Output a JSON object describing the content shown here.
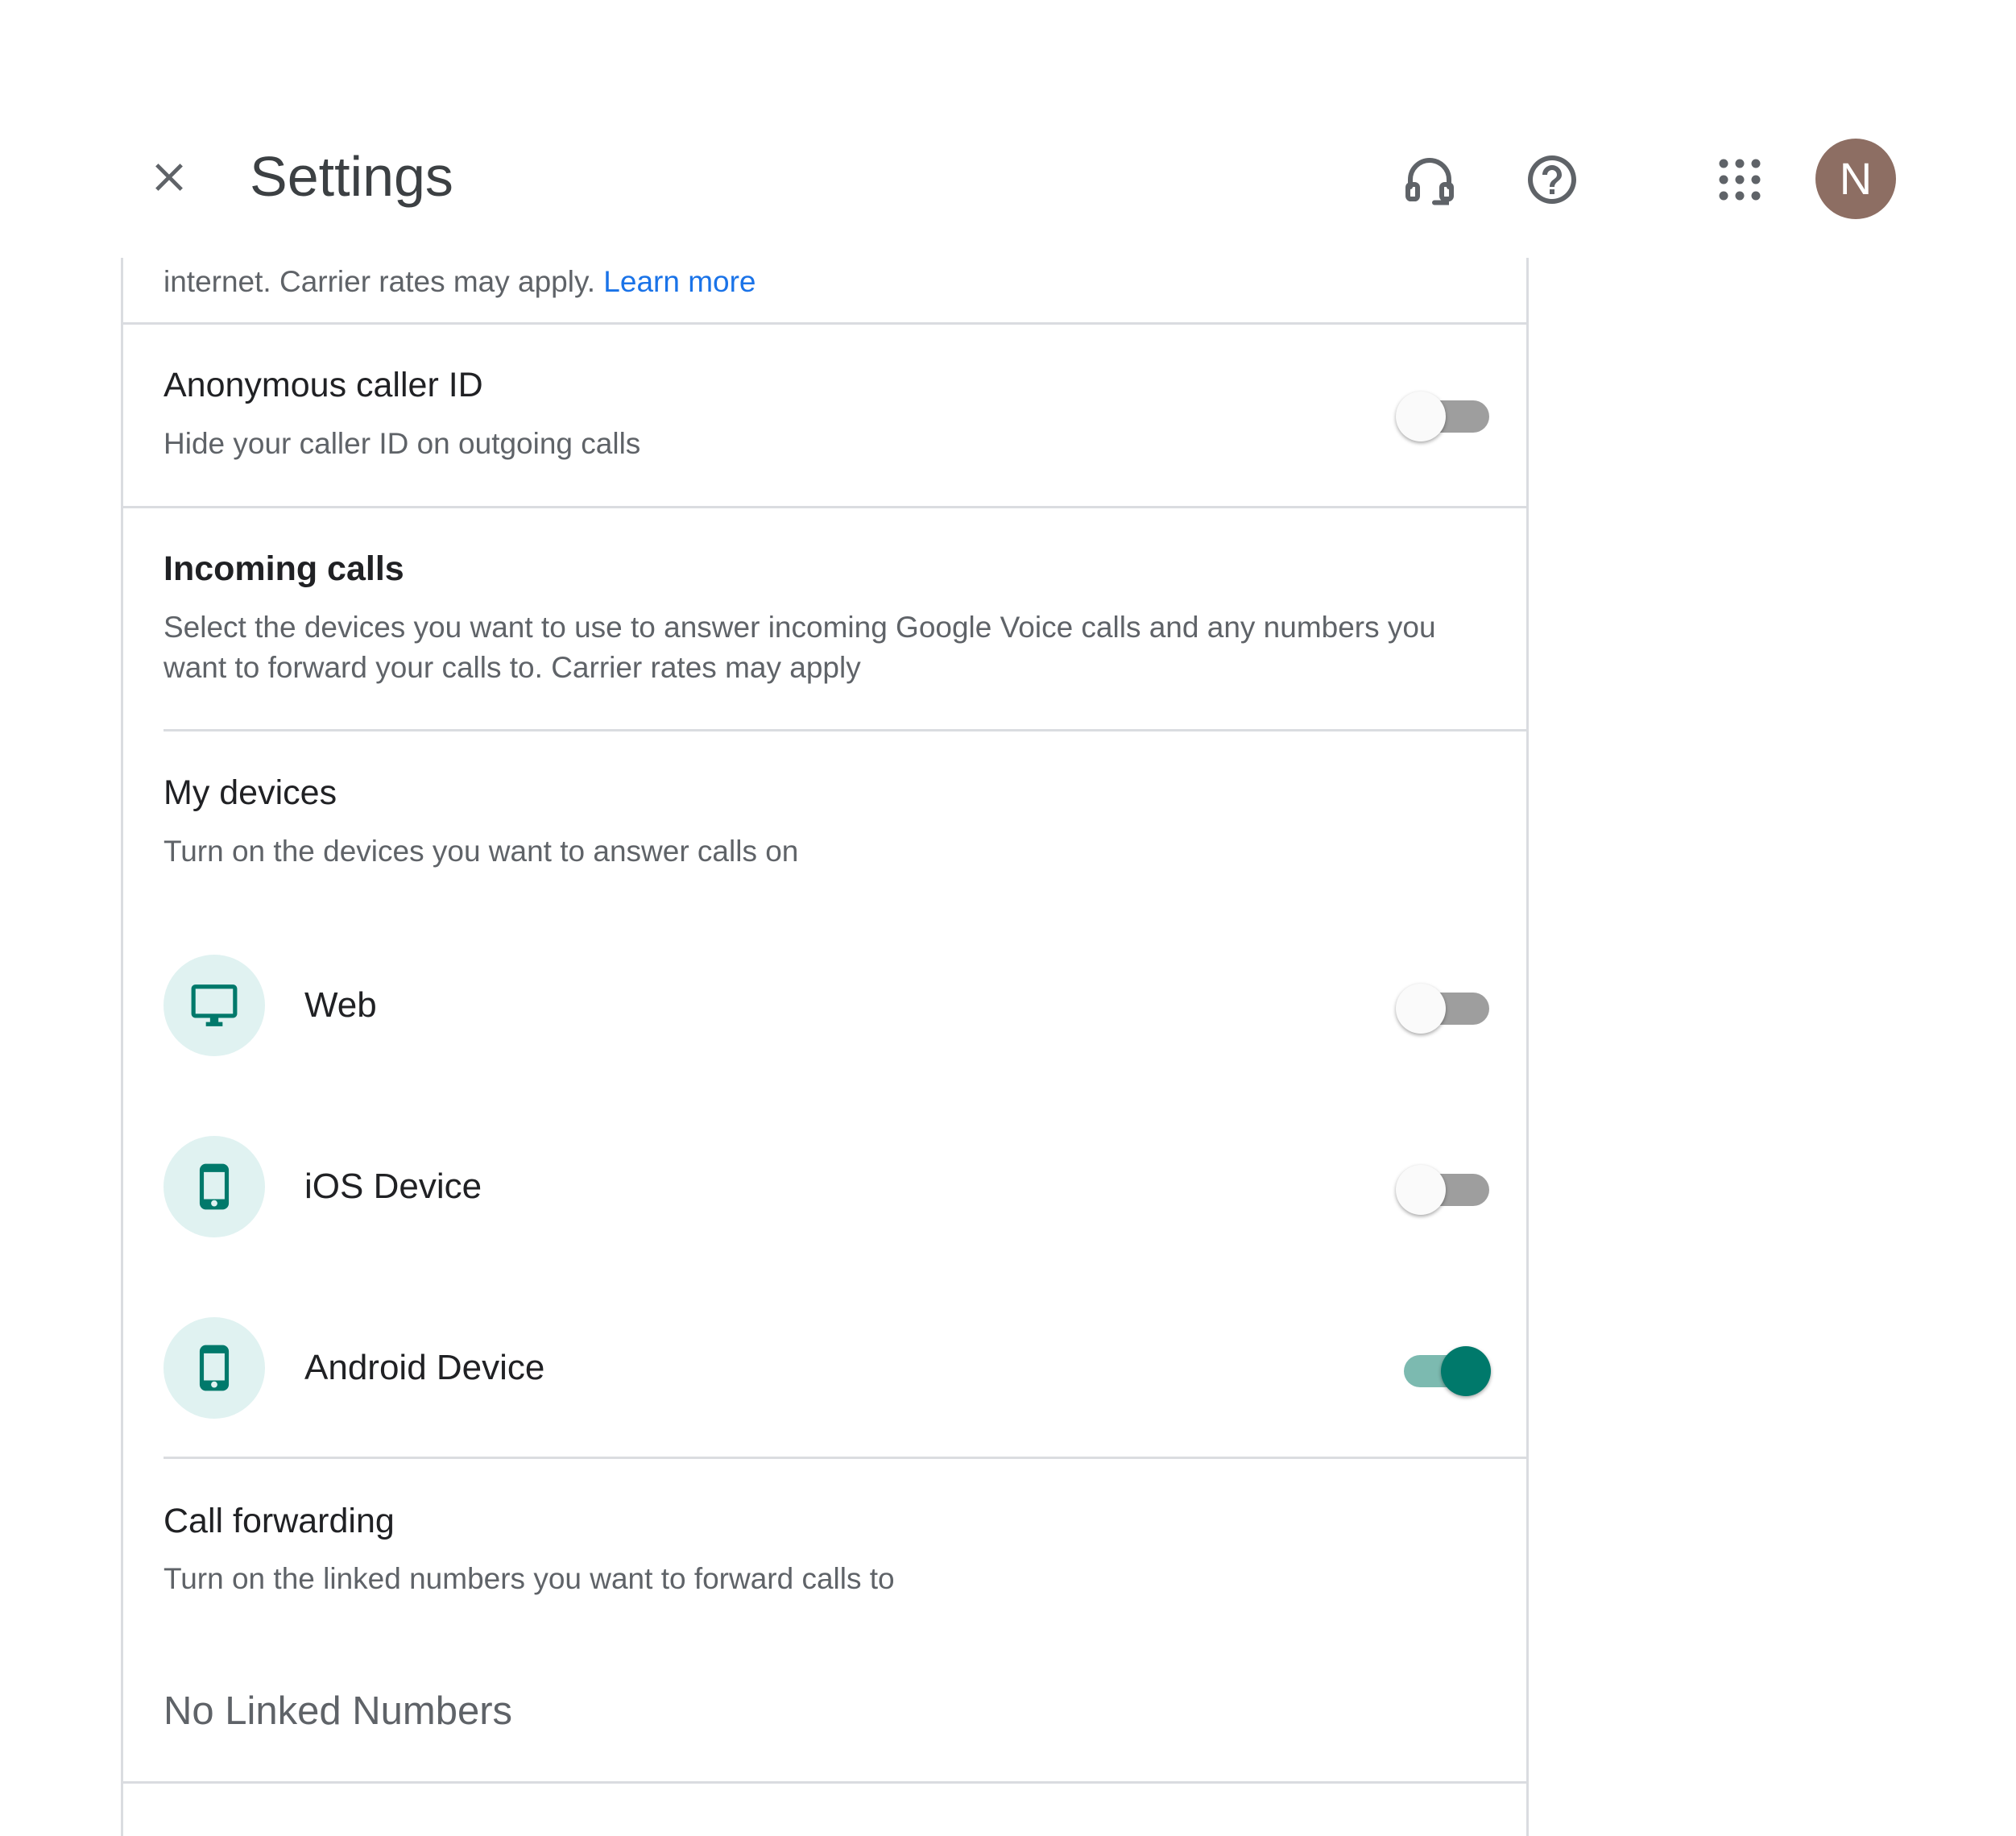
{
  "header": {
    "title": "Settings",
    "avatar_initial": "N"
  },
  "icons": {
    "close": "close-icon",
    "support": "headset-icon",
    "help": "help-circle-icon",
    "apps": "apps-grid-icon",
    "web_device": "monitor-icon",
    "ios_device": "smartphone-icon",
    "android_device": "smartphone-icon"
  },
  "colors": {
    "accent": "#00796b",
    "accent_light": "#e0f2f1",
    "link": "#1a73e8",
    "avatar": "#8d6e63"
  },
  "top_text": {
    "prefix": "internet. Carrier rates may apply.",
    "link": "Learn more"
  },
  "anonymous": {
    "title": "Anonymous caller ID",
    "subtitle": "Hide your caller ID on outgoing calls",
    "enabled": false
  },
  "incoming": {
    "title": "Incoming calls",
    "description": "Select the devices you want to use to answer incoming Google Voice calls and any numbers you want to forward your calls to. Carrier rates may apply"
  },
  "my_devices": {
    "title": "My devices",
    "subtitle": "Turn on the devices you want to answer calls on",
    "items": [
      {
        "label": "Web",
        "enabled": false
      },
      {
        "label": "iOS Device",
        "enabled": false
      },
      {
        "label": "Android Device",
        "enabled": true
      }
    ]
  },
  "call_forwarding": {
    "title": "Call forwarding",
    "subtitle": "Turn on the linked numbers you want to forward calls to",
    "empty_text": "No Linked Numbers"
  }
}
